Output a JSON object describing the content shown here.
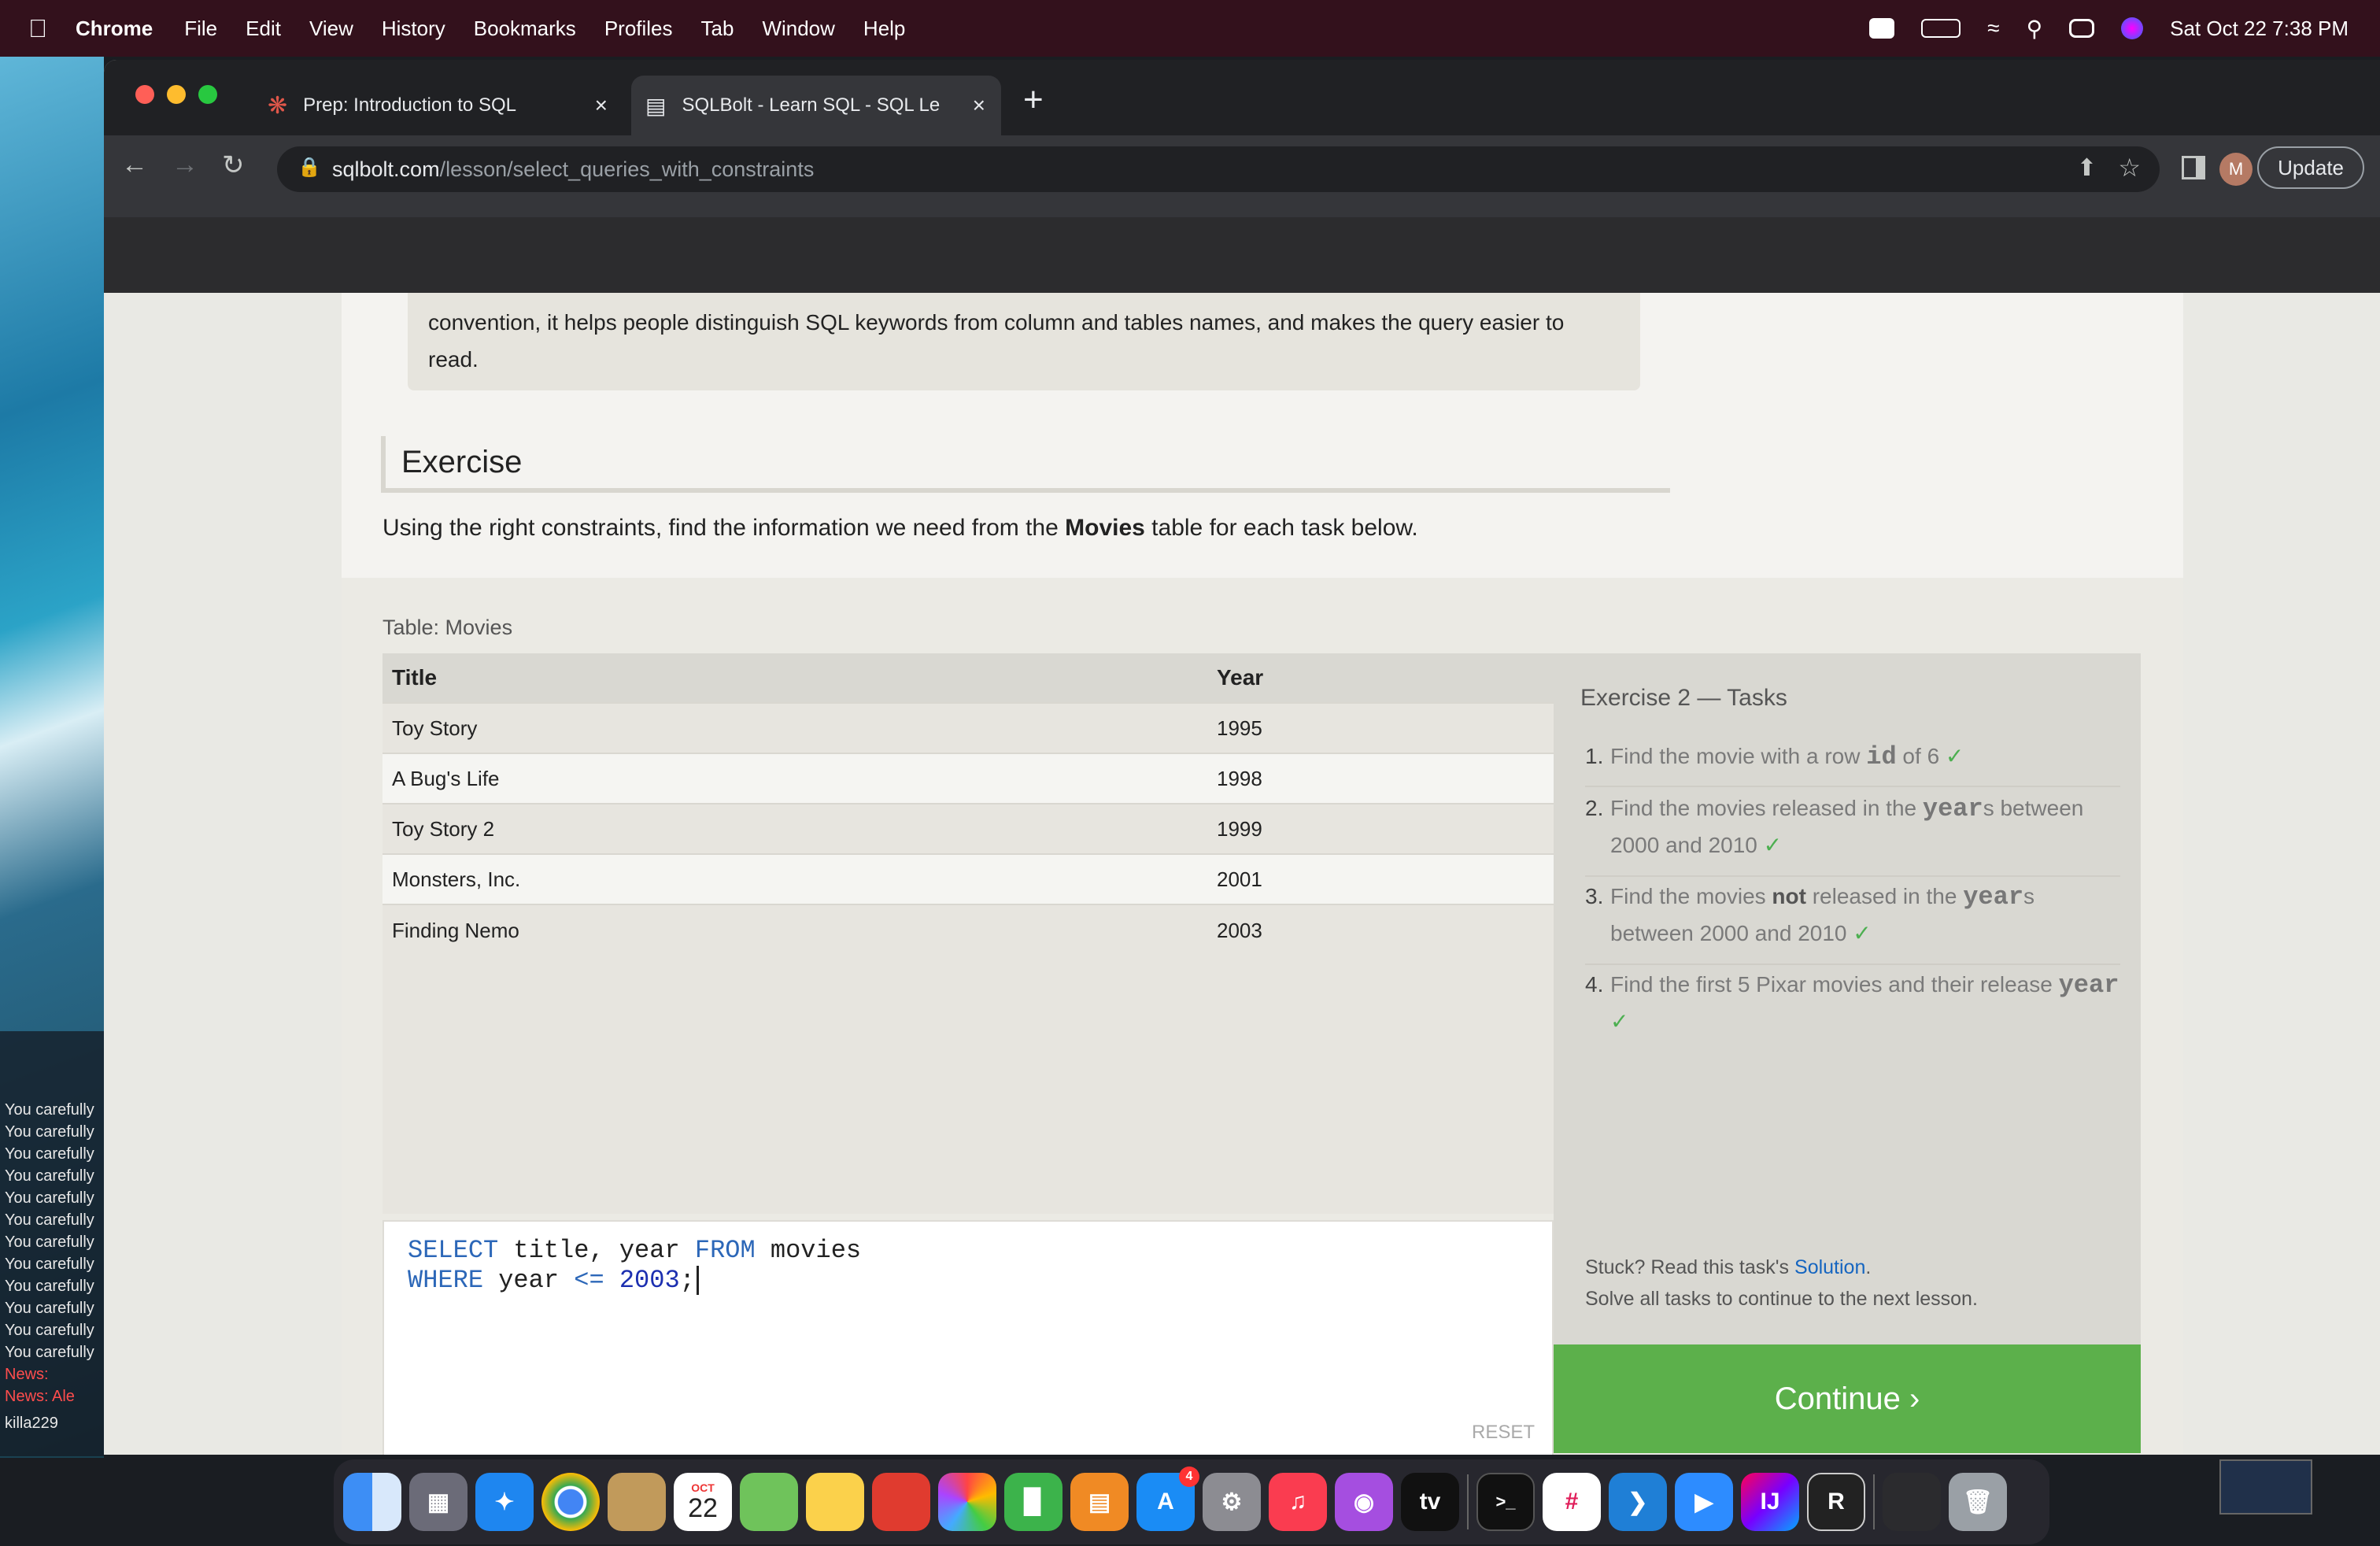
{
  "menubar": {
    "app": "Chrome",
    "items": [
      "File",
      "Edit",
      "View",
      "History",
      "Bookmarks",
      "Profiles",
      "Tab",
      "Window",
      "Help"
    ],
    "clock": "Sat Oct 22  7:38 PM"
  },
  "game_chat": {
    "lines": [
      "You carefully",
      "You carefully",
      "You carefully",
      "You carefully",
      "You carefully",
      "You carefully",
      "You carefully",
      "You carefully",
      "You carefully",
      "You carefully",
      "You carefully",
      "You carefully"
    ],
    "news1": "News:",
    "news2": "News: Ale",
    "player": "killa229"
  },
  "tabs": [
    {
      "label": "Prep: Introduction to SQL",
      "icon": "gear-red-icon"
    },
    {
      "label": "SQLBolt - Learn SQL - SQL Le",
      "icon": "database-icon"
    }
  ],
  "address": {
    "host": "sqlbolt.com",
    "path": "/lesson/select_queries_with_constraints"
  },
  "toolbar": {
    "update_label": "Update",
    "avatar_initial": "M"
  },
  "lesson": {
    "note_text": "convention, it helps people distinguish SQL keywords from column and tables names, and makes the query easier to read.",
    "exercise_heading": "Exercise",
    "exercise_desc_pre": "Using the right constraints, find the information we need from the ",
    "exercise_desc_bold": "Movies",
    "exercise_desc_post": " table for each task below."
  },
  "table": {
    "label": "Table: Movies",
    "headers": [
      "Title",
      "Year"
    ],
    "rows": [
      [
        "Toy Story",
        "1995"
      ],
      [
        "A Bug's Life",
        "1998"
      ],
      [
        "Toy Story 2",
        "1999"
      ],
      [
        "Monsters, Inc.",
        "2001"
      ],
      [
        "Finding Nemo",
        "2003"
      ]
    ]
  },
  "editor": {
    "line1": {
      "kw1": "SELECT",
      "mid": " title, year ",
      "kw2": "FROM",
      "end": " movies"
    },
    "line2": {
      "kw1": "WHERE",
      "mid": " year ",
      "op": "<=",
      "num": " 2003",
      "end": ";"
    },
    "reset_label": "RESET"
  },
  "tasks": {
    "title": "Exercise 2 — Tasks",
    "items": [
      {
        "num": "1.",
        "a": "Find the movie with a row ",
        "code": "id",
        "b": " of 6 "
      },
      {
        "num": "2.",
        "a": "Find the movies released in the ",
        "code": "year",
        "b": "s between 2000 and 2010 "
      },
      {
        "num": "3.",
        "a": "Find the movies ",
        "bold": "not",
        "a2": " released in the ",
        "code": "year",
        "b": "s between 2000 and 2010 "
      },
      {
        "num": "4.",
        "a": "Find the first 5 Pixar movies and their release ",
        "code": "year",
        "b": " "
      }
    ],
    "check": "✓",
    "stuck_pre": "Stuck? Read this task's ",
    "stuck_link": "Solution",
    "stuck_post": ".",
    "solve_all": "Solve all tasks to continue to the next lesson.",
    "continue_label": "Continue ›"
  },
  "dock": {
    "calendar_month": "OCT",
    "calendar_day": "22",
    "appstore_badge": "4"
  }
}
